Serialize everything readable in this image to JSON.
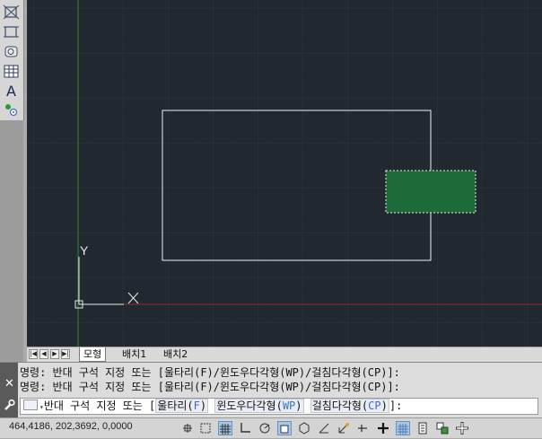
{
  "toolbar": {
    "icons": [
      "polyline-cross-icon",
      "polyline-rect-icon",
      "region-icon",
      "table-icon",
      "text-icon",
      "point-icon"
    ],
    "text_tool_label": "A"
  },
  "viewport": {
    "ucs": {
      "y_label": "Y",
      "x_label": "X"
    },
    "colors": {
      "background": "#212830",
      "grid": "#2b323c",
      "y_axis": "#2f8a2f",
      "x_axis": "#8a2b2b",
      "rectangle": "#ffffff",
      "selection_fill": "#1e6b3a"
    }
  },
  "tabs": {
    "nav_buttons": [
      "|◀",
      "◀",
      "▶",
      "▶|"
    ],
    "items": [
      {
        "label": "모형",
        "active": true
      },
      {
        "label": "배치1",
        "active": false
      },
      {
        "label": "배치2",
        "active": false
      }
    ]
  },
  "command": {
    "history": [
      "명령: 반대 구석 지정 또는 [울타리(F)/윈도우다각형(WP)/걸침다각형(CP)]:",
      "명령: 반대 구석 지정 또는 [울타리(F)/윈도우다각형(WP)/걸침다각형(CP)]:"
    ],
    "prompt_prefix": "반대 구석 지정 또는 [",
    "options": [
      {
        "label": "울타리(",
        "key": "F",
        "close": ")"
      },
      {
        "label": "윈도우다각형(",
        "key": "WP",
        "close": ")"
      },
      {
        "label": "걸침다각형(",
        "key": "CP",
        "close": ")"
      }
    ],
    "prompt_suffix": "]:",
    "close_label": "✕"
  },
  "statusbar": {
    "coordinates": "464,4186, 202,3692, 0,0000",
    "toggles": [
      {
        "icon": "infer-constraints-icon",
        "on": false
      },
      {
        "icon": "snap-mode-icon",
        "on": false
      },
      {
        "icon": "grid-display-icon",
        "on": true
      },
      {
        "icon": "ortho-mode-icon",
        "on": false
      },
      {
        "icon": "polar-tracking-icon",
        "on": false
      },
      {
        "icon": "object-snap-icon",
        "on": true
      },
      {
        "icon": "3d-object-snap-icon",
        "on": false
      },
      {
        "icon": "object-snap-tracking-icon",
        "on": false
      },
      {
        "icon": "dynamic-ucs-icon",
        "on": false
      },
      {
        "icon": "dynamic-input-icon",
        "on": false
      },
      {
        "icon": "lineweight-icon",
        "on": false
      },
      {
        "icon": "transparency-icon",
        "on": true
      },
      {
        "icon": "quick-properties-icon",
        "on": false
      },
      {
        "icon": "selection-cycling-icon",
        "on": false
      },
      {
        "icon": "annotation-monitor-icon",
        "on": false
      }
    ]
  }
}
